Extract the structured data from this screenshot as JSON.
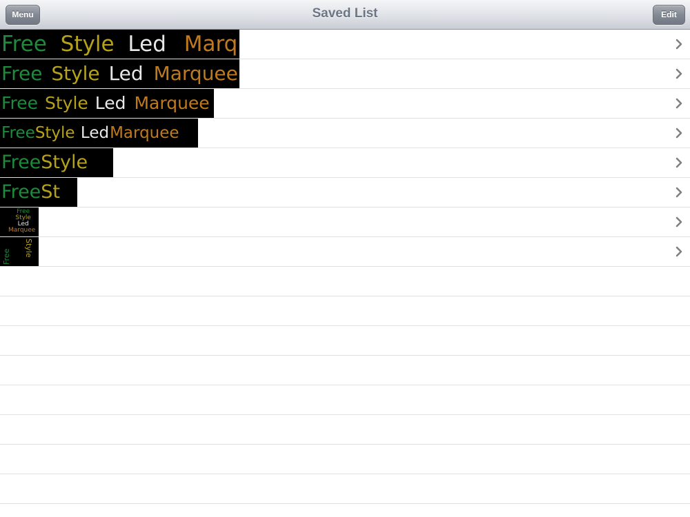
{
  "nav": {
    "title": "Saved List",
    "menu_label": "Menu",
    "edit_label": "Edit"
  },
  "rows": [
    {
      "text": "Free Style Led Marquee",
      "words": [
        "Free",
        "Style",
        "Led",
        "Marquee"
      ]
    },
    {
      "text": "Free Style Led Marquee",
      "words": [
        "Free",
        "Style",
        "Led",
        "Marquee"
      ]
    },
    {
      "text": "Free Style Led Marquee",
      "words": [
        "Free",
        "Style",
        "Led",
        "Marquee"
      ]
    },
    {
      "text": "FreeStyle Led Marquee",
      "words": [
        "Free",
        "Style",
        "Led",
        "Marquee"
      ]
    },
    {
      "text": "FreeStyle",
      "words": [
        "Free",
        "Style"
      ]
    },
    {
      "text": "FreeSt",
      "words": [
        "Free",
        "St"
      ]
    },
    {
      "text": "Free Style Led Marquee",
      "words": [
        "Free",
        "Style",
        "Led",
        "Marquee"
      ]
    },
    {
      "text": "Free Style",
      "words": [
        "Free",
        "Style"
      ]
    }
  ],
  "colors": {
    "free": "#1f8a3c",
    "style_s": "#b6a21a",
    "style_rest": "#7a3fb0",
    "led_l": "#e8e8e8",
    "led_rest": "#c0282d",
    "marquee": "#c07a1e",
    "chevron": "#808080"
  }
}
